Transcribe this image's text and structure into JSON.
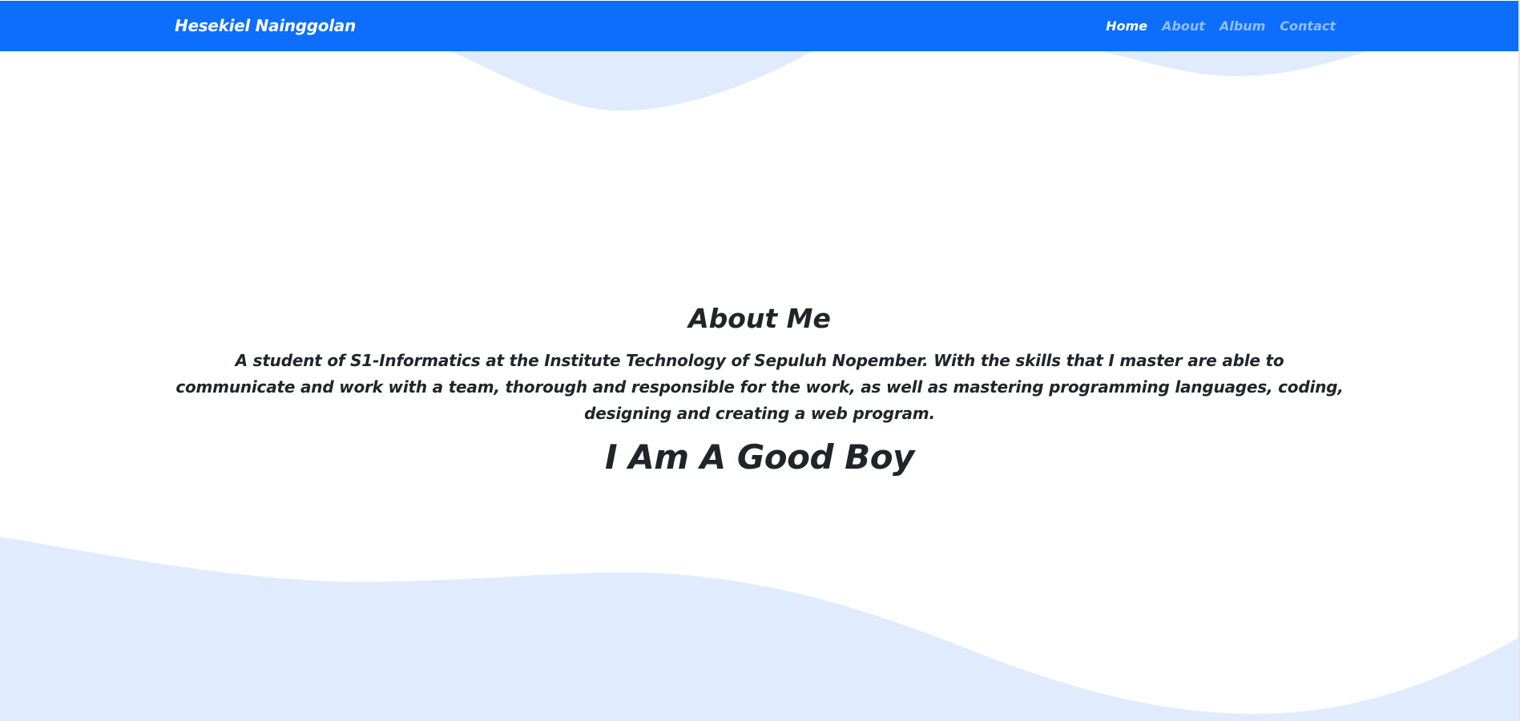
{
  "navbar": {
    "brand": "Hesekiel Nainggolan",
    "color": "#0d6efd",
    "links": [
      {
        "label": "Home",
        "active": true
      },
      {
        "label": "About",
        "active": false
      },
      {
        "label": "Album",
        "active": false
      },
      {
        "label": "Contact",
        "active": false
      }
    ]
  },
  "about": {
    "heading": "About Me",
    "text": "A student of S1-Informatics at the Institute Technology of Sepuluh Nopember. With the skills that I master are able to communicate and work with a team, thorough and responsible for the work, as well as mastering programming languages, coding, designing and creating a web program.",
    "tagline": "I Am A Good Boy"
  },
  "colors": {
    "wave": "#e0ecfd",
    "text": "#212529"
  }
}
